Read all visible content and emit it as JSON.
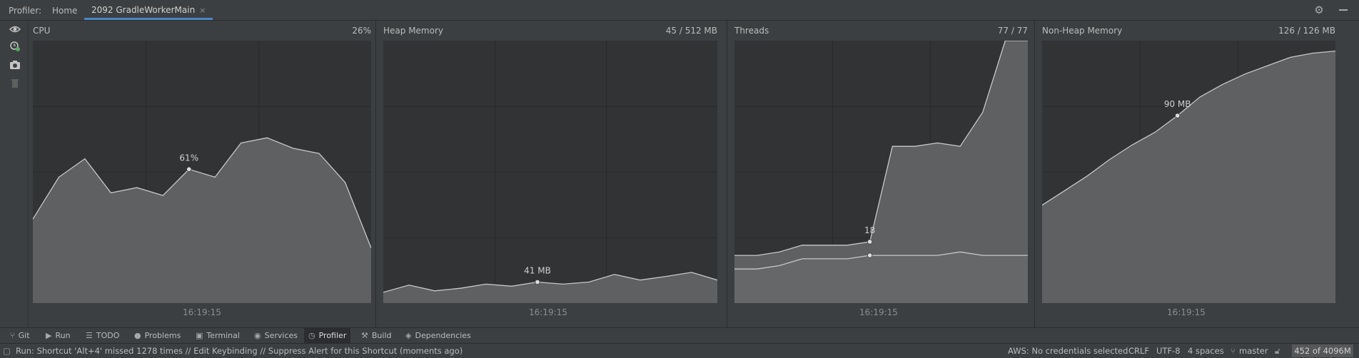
{
  "header": {
    "profiler_label": "Profiler:",
    "home_tab": "Home",
    "active_tab": "2092 GradleWorkerMain",
    "close_glyph": "×",
    "settings_icon": "gear-icon",
    "minimize_icon": "minimize-icon"
  },
  "side_tools": [
    "eye-icon",
    "attach-icon",
    "snapshot-icon",
    "trash-icon"
  ],
  "panels": {
    "cpu": {
      "title": "CPU",
      "value": "26%",
      "time": "16:19:15",
      "marker_label": "61%"
    },
    "heap": {
      "title": "Heap Memory",
      "value": "45 / 512 MB",
      "time": "16:19:15",
      "marker_label": "41 MB"
    },
    "threads": {
      "title": "Threads",
      "value": "77 / 77",
      "time": "16:19:15",
      "marker_label": "18"
    },
    "nonheap": {
      "title": "Non-Heap Memory",
      "value": "126 / 126 MB",
      "time": "16:19:15",
      "marker_label": "90 MB"
    }
  },
  "chart_data": [
    {
      "type": "area",
      "title": "CPU",
      "ylim": [
        0,
        100
      ],
      "series": [
        {
          "values": [
            32,
            48,
            55,
            42,
            44,
            41,
            51,
            48,
            61,
            63,
            59,
            57,
            46,
            21
          ]
        }
      ],
      "marker": {
        "index": 6,
        "label": "61%"
      }
    },
    {
      "type": "area",
      "title": "Heap Memory",
      "ylim": [
        0,
        512
      ],
      "series": [
        {
          "values": [
            21,
            35,
            24,
            29,
            37,
            33,
            41,
            37,
            41,
            56,
            45,
            52,
            60,
            45
          ]
        }
      ],
      "marker": {
        "index": 6,
        "label": "41 MB"
      }
    },
    {
      "type": "area",
      "title": "Threads",
      "ylim": [
        0,
        77
      ],
      "series": [
        {
          "values": [
            14,
            14,
            15,
            17,
            17,
            17,
            18,
            46,
            46,
            47,
            46,
            56,
            77,
            77
          ]
        },
        {
          "values": [
            10,
            10,
            11,
            13,
            13,
            13,
            14,
            14,
            14,
            14,
            15,
            14,
            14,
            14
          ]
        }
      ],
      "marker": {
        "index": 6,
        "label": "18"
      }
    },
    {
      "type": "area",
      "title": "Non-Heap Memory",
      "ylim": [
        0,
        126
      ],
      "series": [
        {
          "values": [
            47,
            54,
            61,
            69,
            76,
            82,
            90,
            99,
            105,
            110,
            114,
            118,
            120,
            121
          ]
        }
      ],
      "marker": {
        "index": 6,
        "label": "90 MB"
      }
    }
  ],
  "bottom_tools": [
    {
      "icon": "git-icon",
      "label": "Git"
    },
    {
      "icon": "run-icon",
      "label": "Run"
    },
    {
      "icon": "todo-icon",
      "label": "TODO"
    },
    {
      "icon": "problems-icon",
      "label": "Problems"
    },
    {
      "icon": "terminal-icon",
      "label": "Terminal"
    },
    {
      "icon": "services-icon",
      "label": "Services"
    },
    {
      "icon": "profiler-icon",
      "label": "Profiler",
      "active": true
    },
    {
      "icon": "build-icon",
      "label": "Build"
    },
    {
      "icon": "dependencies-icon",
      "label": "Dependencies"
    }
  ],
  "status": {
    "message": "Run: Shortcut 'Alt+4' missed 1278 times // Edit Keybinding // Suppress Alert for this Shortcut (moments ago)",
    "aws": "AWS: No credentials selected",
    "line_sep": "CRLF",
    "encoding": "UTF-8",
    "indent": "4 spaces",
    "branch": "master",
    "memory": "452 of 4096M"
  },
  "colors": {
    "bg": "#3c3f41",
    "plot_bg": "#313335",
    "area_fill": "#5f6061",
    "line": "#c8c8c8",
    "accent": "#4a88c7"
  }
}
